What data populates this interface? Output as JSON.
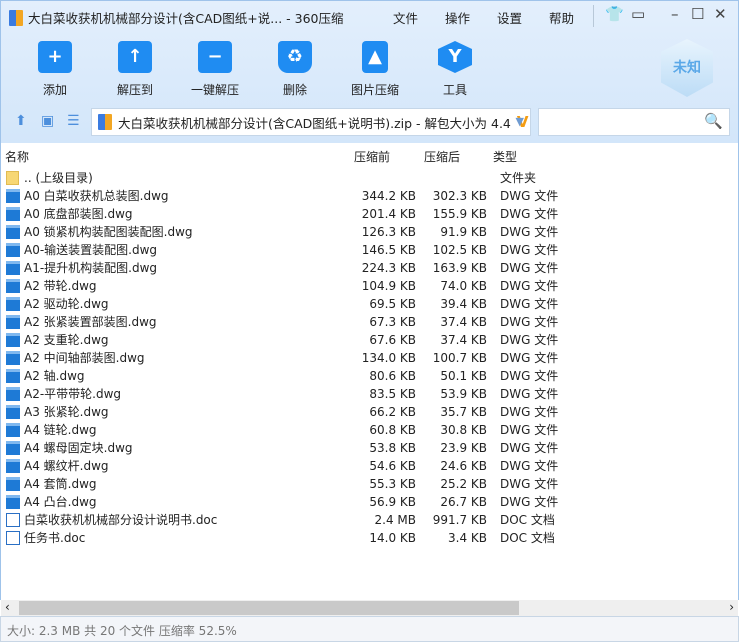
{
  "window": {
    "title": "大白菜收获机机械部分设计(含CAD图纸+说... - 360压缩",
    "menus": [
      "文件",
      "操作",
      "设置",
      "帮助"
    ]
  },
  "toolbar": [
    {
      "label": "添加",
      "icon": "+"
    },
    {
      "label": "解压到",
      "icon": "↑"
    },
    {
      "label": "一键解压",
      "icon": "−"
    },
    {
      "label": "删除",
      "icon": "♻"
    },
    {
      "label": "图片压缩",
      "icon": "▲"
    },
    {
      "label": "工具",
      "icon": "Y"
    }
  ],
  "badge": "未知",
  "address": {
    "path": "大白菜收获机机械部分设计(含CAD图纸+说明书).zip - 解包大小为 4.4"
  },
  "columns": {
    "name": "名称",
    "before": "压缩前",
    "after": "压缩后",
    "type": "类型"
  },
  "files": [
    {
      "name": ".. (上级目录)",
      "before": "",
      "after": "",
      "type": "文件夹",
      "kind": "folder"
    },
    {
      "name": "A0 白菜收获机总装图.dwg",
      "before": "344.2 KB",
      "after": "302.3 KB",
      "type": "DWG 文件",
      "kind": "dwg"
    },
    {
      "name": "A0 底盘部装图.dwg",
      "before": "201.4 KB",
      "after": "155.9 KB",
      "type": "DWG 文件",
      "kind": "dwg"
    },
    {
      "name": "A0 锁紧机构装配图装配图.dwg",
      "before": "126.3 KB",
      "after": "91.9 KB",
      "type": "DWG 文件",
      "kind": "dwg"
    },
    {
      "name": "A0-输送装置装配图.dwg",
      "before": "146.5 KB",
      "after": "102.5 KB",
      "type": "DWG 文件",
      "kind": "dwg"
    },
    {
      "name": "A1-提升机构装配图.dwg",
      "before": "224.3 KB",
      "after": "163.9 KB",
      "type": "DWG 文件",
      "kind": "dwg"
    },
    {
      "name": "A2 带轮.dwg",
      "before": "104.9 KB",
      "after": "74.0 KB",
      "type": "DWG 文件",
      "kind": "dwg"
    },
    {
      "name": "A2 驱动轮.dwg",
      "before": "69.5 KB",
      "after": "39.4 KB",
      "type": "DWG 文件",
      "kind": "dwg"
    },
    {
      "name": "A2 张紧装置部装图.dwg",
      "before": "67.3 KB",
      "after": "37.4 KB",
      "type": "DWG 文件",
      "kind": "dwg"
    },
    {
      "name": "A2 支重轮.dwg",
      "before": "67.6 KB",
      "after": "37.4 KB",
      "type": "DWG 文件",
      "kind": "dwg"
    },
    {
      "name": "A2 中间轴部装图.dwg",
      "before": "134.0 KB",
      "after": "100.7 KB",
      "type": "DWG 文件",
      "kind": "dwg"
    },
    {
      "name": "A2 轴.dwg",
      "before": "80.6 KB",
      "after": "50.1 KB",
      "type": "DWG 文件",
      "kind": "dwg"
    },
    {
      "name": "A2-平带带轮.dwg",
      "before": "83.5 KB",
      "after": "53.9 KB",
      "type": "DWG 文件",
      "kind": "dwg"
    },
    {
      "name": "A3 张紧轮.dwg",
      "before": "66.2 KB",
      "after": "35.7 KB",
      "type": "DWG 文件",
      "kind": "dwg"
    },
    {
      "name": "A4 链轮.dwg",
      "before": "60.8 KB",
      "after": "30.8 KB",
      "type": "DWG 文件",
      "kind": "dwg"
    },
    {
      "name": "A4 螺母固定块.dwg",
      "before": "53.8 KB",
      "after": "23.9 KB",
      "type": "DWG 文件",
      "kind": "dwg"
    },
    {
      "name": "A4 螺纹杆.dwg",
      "before": "54.6 KB",
      "after": "24.6 KB",
      "type": "DWG 文件",
      "kind": "dwg"
    },
    {
      "name": "A4 套筒.dwg",
      "before": "55.3 KB",
      "after": "25.2 KB",
      "type": "DWG 文件",
      "kind": "dwg"
    },
    {
      "name": "A4 凸台.dwg",
      "before": "56.9 KB",
      "after": "26.7 KB",
      "type": "DWG 文件",
      "kind": "dwg"
    },
    {
      "name": "白菜收获机机械部分设计说明书.doc",
      "before": "2.4 MB",
      "after": "991.7 KB",
      "type": "DOC 文档",
      "kind": "doc"
    },
    {
      "name": "任务书.doc",
      "before": "14.0 KB",
      "after": "3.4 KB",
      "type": "DOC 文档",
      "kind": "doc"
    }
  ],
  "status": "大小: 2.3 MB 共 20 个文件 压缩率 52.5%"
}
